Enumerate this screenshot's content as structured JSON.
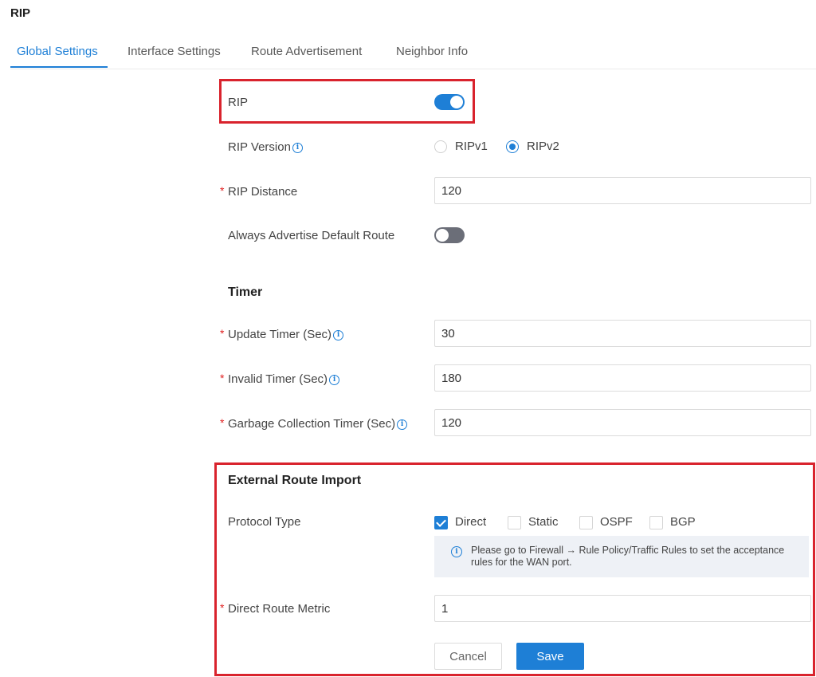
{
  "page_title": "RIP",
  "tabs": [
    {
      "label": "Global Settings",
      "active": true
    },
    {
      "label": "Interface Settings",
      "active": false
    },
    {
      "label": "Route Advertisement",
      "active": false
    },
    {
      "label": "Neighbor Info",
      "active": false
    }
  ],
  "form": {
    "rip": {
      "label": "RIP",
      "enabled": true
    },
    "rip_version": {
      "label": "RIP Version",
      "options": [
        "RIPv1",
        "RIPv2"
      ],
      "selected": "RIPv2"
    },
    "rip_distance": {
      "label": "RIP Distance",
      "value": "120",
      "required": true
    },
    "always_advertise": {
      "label": "Always Advertise Default Route",
      "enabled": false
    },
    "timer_section": "Timer",
    "update_timer": {
      "label": "Update Timer (Sec)",
      "value": "30",
      "required": true
    },
    "invalid_timer": {
      "label": "Invalid Timer (Sec)",
      "value": "180",
      "required": true
    },
    "garbage_timer": {
      "label": "Garbage Collection Timer (Sec)",
      "value": "120",
      "required": true
    },
    "external_section": "External Route Import",
    "protocol_type": {
      "label": "Protocol Type",
      "options": [
        {
          "label": "Direct",
          "checked": true
        },
        {
          "label": "Static",
          "checked": false
        },
        {
          "label": "OSPF",
          "checked": false
        },
        {
          "label": "BGP",
          "checked": false
        }
      ]
    },
    "notice": "Please go to Firewall → Rule Policy/Traffic Rules to set the acceptance rules for the WAN port.",
    "direct_route_metric": {
      "label": "Direct Route Metric",
      "value": "1",
      "required": true
    },
    "required_mark": "*",
    "info_glyph": "i"
  },
  "buttons": {
    "cancel": "Cancel",
    "save": "Save"
  },
  "colors": {
    "accent": "#1e7fd6",
    "highlight": "#d9232d",
    "toggle_off": "#6b6e78",
    "required": "#e02020"
  }
}
